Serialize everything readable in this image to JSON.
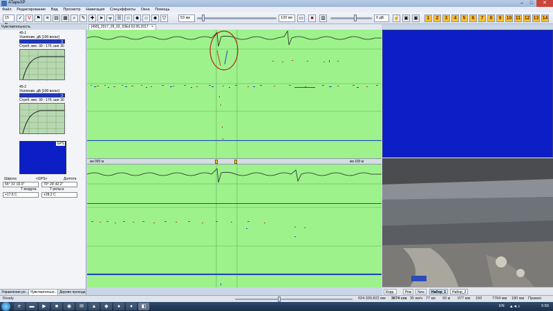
{
  "app": {
    "title": "ATapeXP"
  },
  "menu": [
    "Файл",
    "Редактирование",
    "Вид",
    "Просмотр",
    "Навигация",
    "Спецэффекты",
    "Окна",
    "Помощь"
  ],
  "toolbar": {
    "speed_field": "15 м",
    "field_53": "53 км",
    "field_120": "120 км",
    "db_label": "0 дБ"
  },
  "left_panel": {
    "title": "Чувствительность",
    "ch1": {
      "name": "45-1",
      "gain": "Усиление, дБ  [100 вольт]",
      "gain_value": "3",
      "strob": "Строб, мкс: 30 - 170, шаг 30"
    },
    "ch2": {
      "name": "45-2",
      "gain": "Усиление, дБ  [100 вольт]",
      "gain_value": "3",
      "strob": "Строб, мкс: 30 - 170, шаг 30"
    },
    "gps_badge": "GPS",
    "lat_label": "Широта",
    "gps_label": "<GPS>",
    "lon_label": "Долгота",
    "lat_value": "55° 31' 02.0\"",
    "lon_value": "70° 29' 42.2\"",
    "air_label": "T воздуха",
    "rail_label": "T рельса",
    "air_value": "+17.6 C",
    "rail_value": "+28.2 C",
    "tabs": [
      "Управление ре...",
      "Чувствительно...",
      "Дерево прохода..."
    ]
  },
  "document_tab": "[495]_2017_05_02_03Ed 02.05.2017",
  "ruler": {
    "left": "км 090 м",
    "right": "км 100 м"
  },
  "camera_tabs": [
    "Корр.",
    "Реж",
    "New",
    "Набор_1",
    "Набор_2"
  ],
  "status": {
    "ready": "Ready",
    "coord": "024.339.822 мм",
    "sec": "3674 сек",
    "speed": "35 км/ч",
    "m77": "77 км",
    "m93": "93 м",
    "m977": "977 мм",
    "n150": "150",
    "mm7764": "7764 мм",
    "mm180": "180 мм",
    "side": "Правая"
  },
  "taskbar": {
    "lang": "EN",
    "time": "5:59"
  }
}
